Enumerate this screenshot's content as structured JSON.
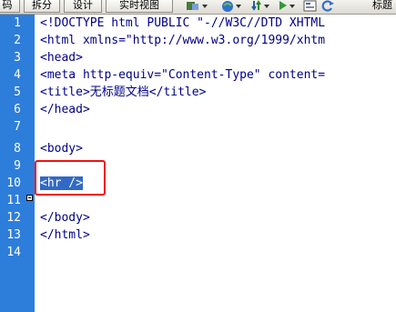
{
  "toolbar": {
    "buttons": [
      "码",
      "拆分",
      "设计",
      "实时视图"
    ],
    "title": "标题"
  },
  "editor": {
    "line_numbers": [
      "1",
      "2",
      "3",
      "4",
      "5",
      "6",
      "7",
      "8",
      "9",
      "10",
      "11",
      "12",
      "13",
      "14"
    ],
    "lines": [
      "<!DOCTYPE html PUBLIC \"-//W3C//DTD XHTML",
      "<html xmlns=\"http://www.w3.org/1999/xhtm",
      "<head>",
      "<meta http-equiv=\"Content-Type\" content=",
      "<title>无标题文档</title>",
      "</head>",
      "",
      "<body>",
      "",
      "<hr />",
      "",
      "</body>",
      "</html>",
      ""
    ],
    "selected_line": 10,
    "selected_text": "<hr />",
    "colors": {
      "gutter": "#2d7ddb",
      "code_text": "#000088",
      "selection": "#3169c6",
      "highlight_box": "#ee1111"
    }
  }
}
